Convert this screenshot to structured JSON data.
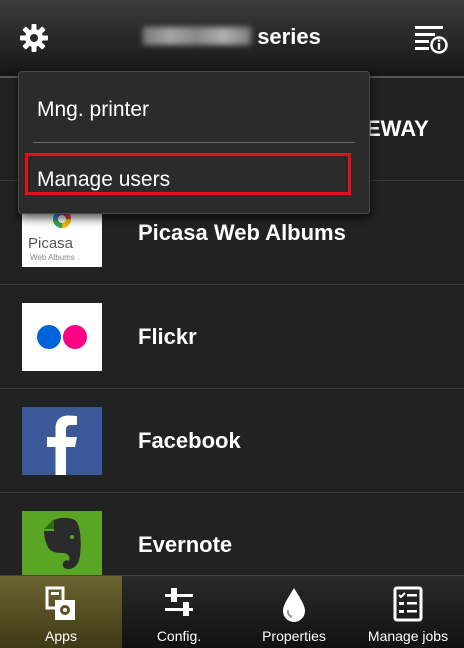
{
  "header": {
    "title": "series",
    "settings_icon": "gear-icon",
    "menu_icon": "menu-info-icon"
  },
  "list": {
    "items": [
      {
        "label": "EWAY",
        "icon": "gateway-logo"
      },
      {
        "label": "Picasa Web Albums",
        "icon": "picasa-logo",
        "logo_text": "Picasa",
        "logo_sub": "Web Albums"
      },
      {
        "label": "Flickr",
        "icon": "flickr-logo"
      },
      {
        "label": "Facebook",
        "icon": "facebook-logo"
      },
      {
        "label": "Evernote",
        "icon": "evernote-logo"
      }
    ]
  },
  "dropdown": {
    "items": [
      {
        "label": "Mng. printer"
      },
      {
        "label": "Manage users",
        "highlighted": true
      }
    ],
    "highlight_color": "#e0131a"
  },
  "bottom_tabs": [
    {
      "label": "Apps",
      "icon": "apps-icon",
      "active": true
    },
    {
      "label": "Config.",
      "icon": "sliders-icon",
      "active": false
    },
    {
      "label": "Properties",
      "icon": "ink-drop-icon",
      "active": false
    },
    {
      "label": "Manage jobs",
      "icon": "job-list-icon",
      "active": false
    }
  ],
  "colors": {
    "background": "#1d1d1d",
    "active_tab": "#6b6330",
    "flickr_blue": "#0063dc",
    "flickr_pink": "#ff0084",
    "facebook_blue": "#3b5998",
    "evernote_green": "#5ba525"
  }
}
